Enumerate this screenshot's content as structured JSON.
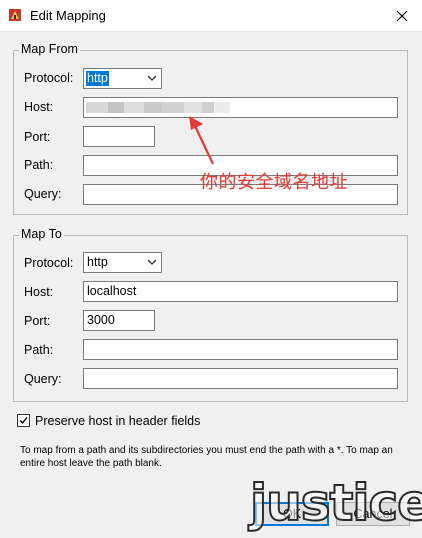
{
  "window": {
    "title": "Edit Mapping"
  },
  "map_from": {
    "legend": "Map From",
    "protocol_label": "Protocol:",
    "protocol_value": "http",
    "host_label": "Host:",
    "host_value": "",
    "port_label": "Port:",
    "port_value": "",
    "path_label": "Path:",
    "path_value": "",
    "query_label": "Query:",
    "query_value": ""
  },
  "map_to": {
    "legend": "Map To",
    "protocol_label": "Protocol:",
    "protocol_value": "http",
    "host_label": "Host:",
    "host_value": "localhost",
    "port_label": "Port:",
    "port_value": "3000",
    "path_label": "Path:",
    "path_value": "",
    "query_label": "Query:",
    "query_value": ""
  },
  "preserve_host": {
    "label": "Preserve host in header fields",
    "checked": true
  },
  "note": "To map from a path and its subdirectories you must end the path with a *. To map an entire host leave the path blank.",
  "annotation": {
    "text": "你的安全域名地址",
    "color": "#e53935"
  },
  "buttons": {
    "ok": "OK",
    "cancel": "Cancel"
  },
  "watermark": "justice",
  "colors": {
    "accent": "#0078d7"
  }
}
